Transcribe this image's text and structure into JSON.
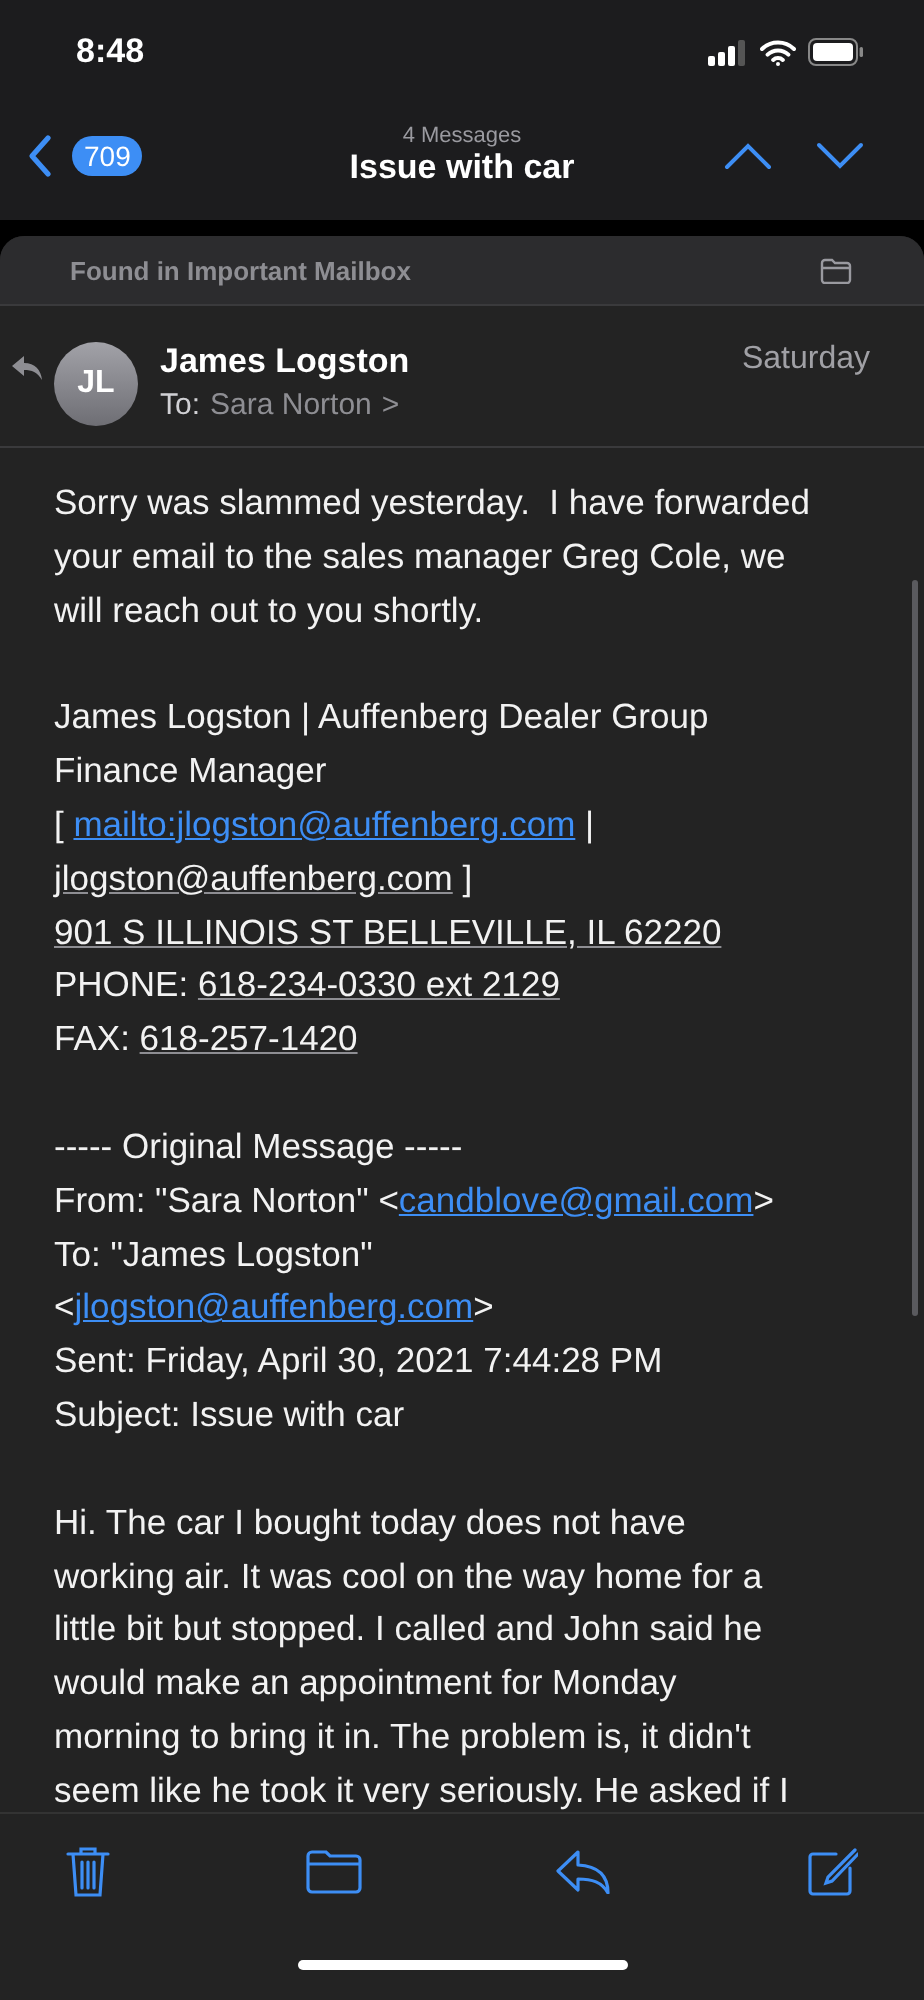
{
  "status_bar": {
    "time": "8:48"
  },
  "nav": {
    "back_count": "709",
    "subtitle": "4 Messages",
    "title": "Issue with car"
  },
  "mailbox_banner": {
    "text": "Found in Important Mailbox"
  },
  "message": {
    "avatar_initials": "JL",
    "replied": true,
    "sender": "James Logston",
    "to_label": "To:",
    "recipient": "Sara Norton",
    "chevron": ">",
    "date": "Saturday",
    "paragraphs": [
      [
        [
          {
            "kind": "plain",
            "text": "Sorry was slammed yesterday.  I have forwarded"
          }
        ],
        [
          {
            "kind": "plain",
            "text": "your email to the sales manager Greg Cole, we"
          }
        ],
        [
          {
            "kind": "plain",
            "text": "will reach out to you shortly."
          }
        ]
      ],
      [
        [
          {
            "kind": "plain",
            "text": "James Logston | Auffenberg Dealer Group"
          }
        ],
        [
          {
            "kind": "plain",
            "text": "Finance Manager"
          }
        ],
        [
          {
            "kind": "plain",
            "text": "[ "
          },
          {
            "kind": "link",
            "text": "mailto:jlogston@auffenberg.com"
          },
          {
            "kind": "plain",
            "text": " |"
          }
        ],
        [
          {
            "kind": "detected",
            "text": "jlogston@auffenberg.com"
          },
          {
            "kind": "plain",
            "text": " ]"
          }
        ],
        [
          {
            "kind": "detected",
            "text": "901 S ILLINOIS ST BELLEVILLE, IL 62220"
          }
        ],
        [
          {
            "kind": "plain",
            "text": "PHONE: "
          },
          {
            "kind": "detected",
            "text": "618-234-0330 ext 2129"
          }
        ],
        [
          {
            "kind": "plain",
            "text": "FAX: "
          },
          {
            "kind": "detected",
            "text": "618-257-1420"
          }
        ]
      ],
      [
        [
          {
            "kind": "plain",
            "text": "----- Original Message -----"
          }
        ],
        [
          {
            "kind": "plain",
            "text": "From: \"Sara Norton\" <"
          },
          {
            "kind": "link",
            "text": "candblove@gmail.com"
          },
          {
            "kind": "plain",
            "text": ">"
          }
        ],
        [
          {
            "kind": "plain",
            "text": "To: \"James Logston\""
          }
        ],
        [
          {
            "kind": "plain",
            "text": "<"
          },
          {
            "kind": "link",
            "text": "jlogston@auffenberg.com"
          },
          {
            "kind": "plain",
            "text": ">"
          }
        ],
        [
          {
            "kind": "plain",
            "text": "Sent: Friday, April 30, 2021 7:44:28 PM"
          }
        ],
        [
          {
            "kind": "plain",
            "text": "Subject: Issue with car"
          }
        ]
      ],
      [
        [
          {
            "kind": "plain",
            "text": "Hi. The car I bought today does not have"
          }
        ],
        [
          {
            "kind": "plain",
            "text": "working air. It was cool on the way home for a"
          }
        ],
        [
          {
            "kind": "plain",
            "text": "little bit but stopped. I called and John said he"
          }
        ],
        [
          {
            "kind": "plain",
            "text": "would make an appointment for Monday"
          }
        ],
        [
          {
            "kind": "plain",
            "text": "morning to bring it in. The problem is, it didn't"
          }
        ],
        [
          {
            "kind": "plain",
            "text": "seem like he took it very seriously. He asked if I"
          }
        ]
      ]
    ]
  }
}
